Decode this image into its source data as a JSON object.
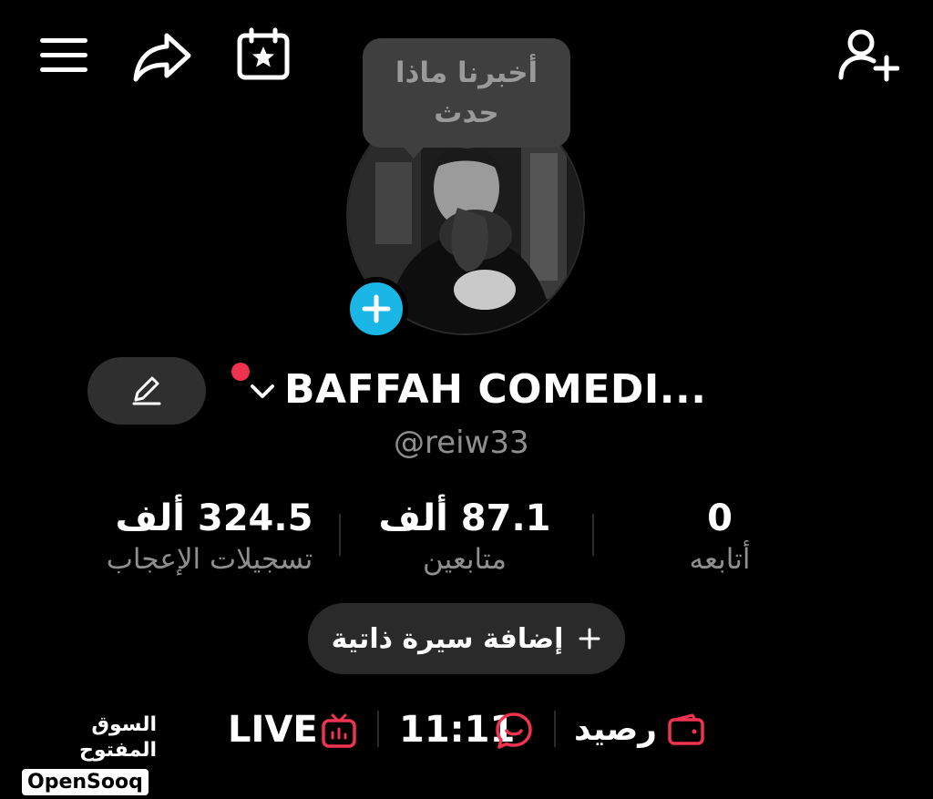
{
  "top_bar": {
    "icons": [
      "menu-icon",
      "share-icon",
      "calendar-star-icon",
      "add-user-icon"
    ]
  },
  "tooltip": {
    "line1": "أخبرنا ماذا",
    "line2": "حدث"
  },
  "profile": {
    "display_name": "BAFFAH COMEDI...",
    "username": "@reiw33",
    "avatar_add_icon": "plus-icon",
    "edit_icon": "pencil-icon",
    "notification_dot_color": "#f0334f"
  },
  "stats": {
    "likes": {
      "value": "324.5 ألف",
      "label": "تسجيلات الإعجاب"
    },
    "followers": {
      "value": "87.1 ألف",
      "label": "متابعين"
    },
    "following": {
      "value": "0",
      "label": "أتابعه"
    }
  },
  "add_bio": {
    "label": "إضافة سيرة ذاتية",
    "icon": "plus-icon"
  },
  "bottom_bar": {
    "watermark_ar": "السوق المفتوح",
    "watermark_en": "OpenSooq",
    "live_label": "LIVE",
    "time_label": "11:11",
    "balance_label": "رصيد",
    "accent_color": "#f0334f"
  }
}
